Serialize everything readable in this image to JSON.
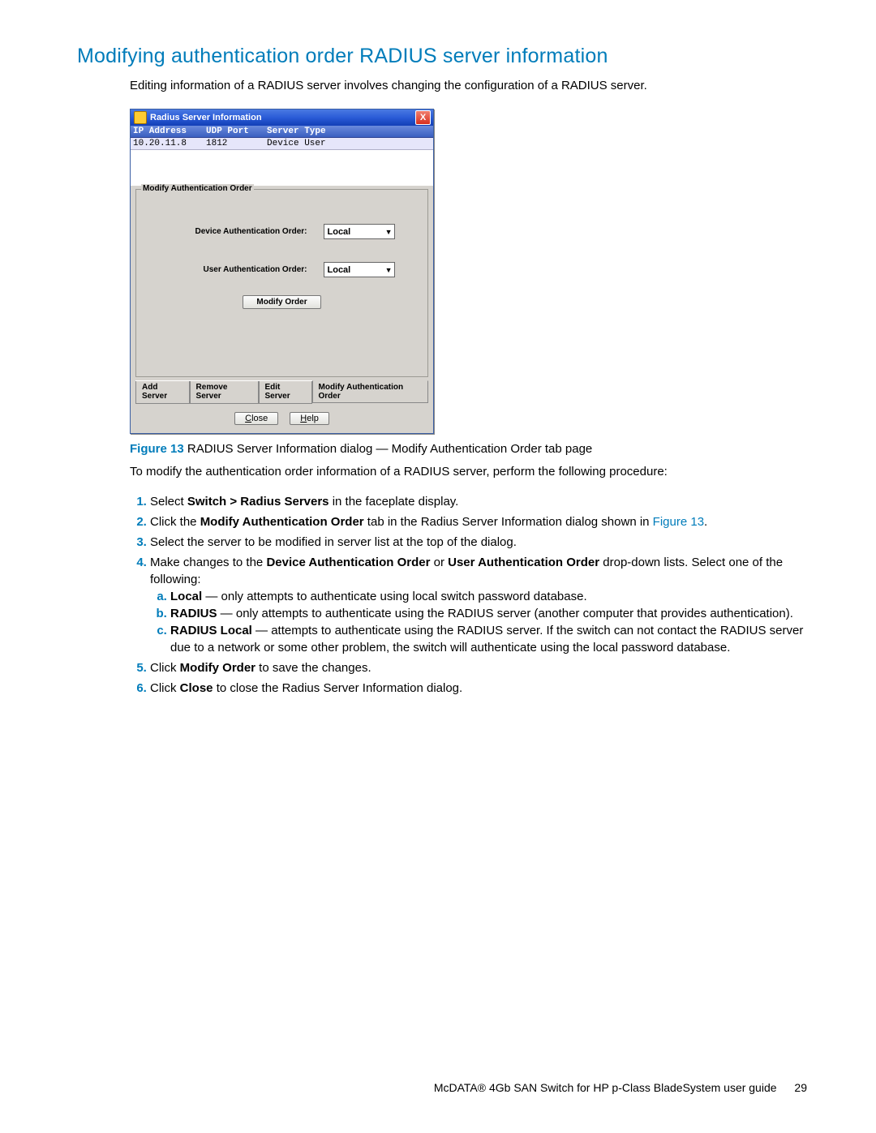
{
  "heading": "Modifying authentication order RADIUS server information",
  "intro": "Editing information of a RADIUS server involves changing the configuration of a RADIUS server.",
  "dialog": {
    "title": "Radius Server Information",
    "close_glyph": "X",
    "headers": {
      "ip": "IP Address",
      "port": "UDP Port",
      "type": "Server Type"
    },
    "row": {
      "ip": "10.20.11.8",
      "port": "1812",
      "type": "Device  User"
    },
    "group_label": "Modify Authentication Order",
    "device_order_label": "Device Authentication Order:",
    "user_order_label": "User Authentication Order:",
    "combo_value": "Local",
    "modify_order_btn": "Modify Order",
    "tabs": {
      "add": "Add Server",
      "remove": "Remove Server",
      "edit": "Edit Server",
      "modify": "Modify Authentication Order"
    },
    "footer": {
      "close": "Close",
      "help": "Help"
    }
  },
  "figure_caption": {
    "label": "Figure 13",
    "text": " RADIUS Server Information dialog — Modify Authentication Order tab page"
  },
  "after_fig": "To modify the authentication order information of a RADIUS server, perform the following procedure:",
  "steps": {
    "s1a": "Select ",
    "s1b": "Switch > Radius Servers",
    "s1c": " in the faceplate display.",
    "s2a": "Click the ",
    "s2b": "Modify Authentication Order",
    "s2c": " tab in the Radius Server Information dialog shown in ",
    "s2d": "Figure 13",
    "s2e": ".",
    "s3": "Select the server to be modified in server list at the top of the dialog.",
    "s4a": "Make changes to the ",
    "s4b": "Device Authentication Order",
    "s4c": " or ",
    "s4d": "User Authentication Order",
    "s4e": " drop-down lists. Select one of the following:",
    "sa_b": "Local",
    "sa_t": " — only attempts to authenticate using local switch password database.",
    "sb_b": "RADIUS",
    "sb_t": " — only attempts to authenticate using the RADIUS server (another computer that provides authentication).",
    "sc_b": "RADIUS Local",
    "sc_t": " — attempts to authenticate using the RADIUS server. If the switch can not contact the RADIUS server due to a network or some other problem, the switch will authenticate using the local password database.",
    "s5a": "Click ",
    "s5b": "Modify Order",
    "s5c": " to save the changes.",
    "s6a": "Click ",
    "s6b": "Close",
    "s6c": " to close the Radius Server Information dialog."
  },
  "footer": {
    "text": "McDATA® 4Gb SAN Switch for HP p-Class BladeSystem user guide",
    "page": "29"
  }
}
